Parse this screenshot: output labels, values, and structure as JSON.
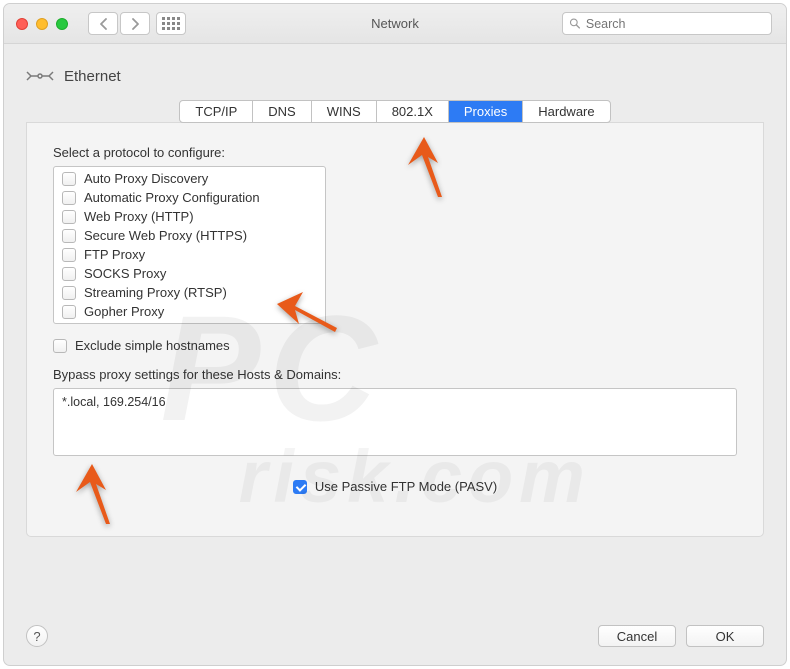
{
  "window": {
    "title": "Network",
    "search_placeholder": "Search"
  },
  "header": {
    "interface": "Ethernet"
  },
  "tabs": {
    "items": [
      "TCP/IP",
      "DNS",
      "WINS",
      "802.1X",
      "Proxies",
      "Hardware"
    ],
    "selected_index": 4
  },
  "proxies": {
    "select_label": "Select a protocol to configure:",
    "protocols": [
      {
        "label": "Auto Proxy Discovery",
        "checked": false
      },
      {
        "label": "Automatic Proxy Configuration",
        "checked": false
      },
      {
        "label": "Web Proxy (HTTP)",
        "checked": false
      },
      {
        "label": "Secure Web Proxy (HTTPS)",
        "checked": false
      },
      {
        "label": "FTP Proxy",
        "checked": false
      },
      {
        "label": "SOCKS Proxy",
        "checked": false
      },
      {
        "label": "Streaming Proxy (RTSP)",
        "checked": false
      },
      {
        "label": "Gopher Proxy",
        "checked": false
      }
    ],
    "exclude_simple_label": "Exclude simple hostnames",
    "exclude_simple_checked": false,
    "bypass_label": "Bypass proxy settings for these Hosts & Domains:",
    "bypass_value": "*.local, 169.254/16",
    "pasv_label": "Use Passive FTP Mode (PASV)",
    "pasv_checked": true
  },
  "footer": {
    "help": "?",
    "cancel": "Cancel",
    "ok": "OK"
  },
  "annotations": {
    "arrow_color": "#e85a1a"
  }
}
